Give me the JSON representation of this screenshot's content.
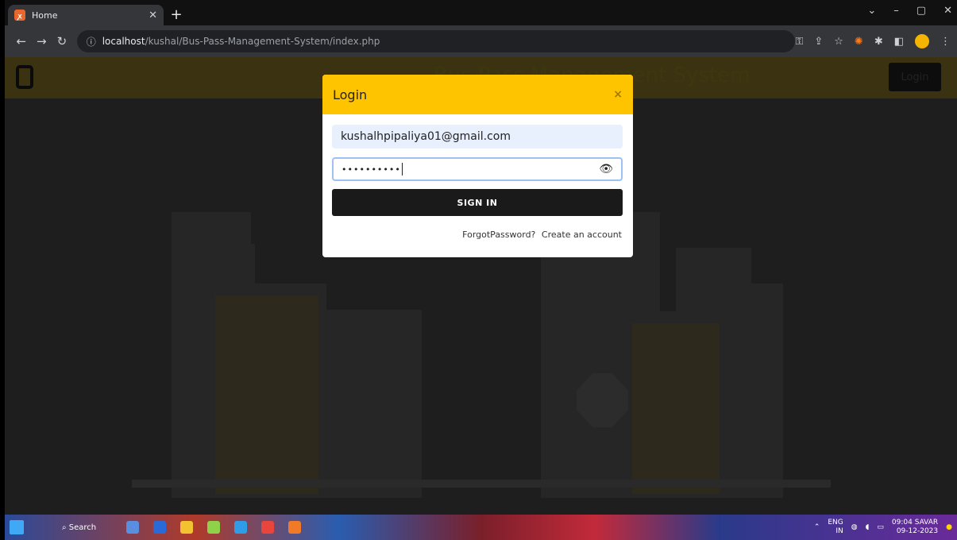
{
  "browser": {
    "tab_title": "Home",
    "tab_favicon": "xampp-icon",
    "url_host": "localhost",
    "url_path": "/kushal/Bus-Pass-Management-System/index.php"
  },
  "site": {
    "title": "Bus Pass Management System",
    "nav_login_label": "Login"
  },
  "modal": {
    "title": "Login",
    "close_label": "×",
    "email_value": "kushalhpipaliya01@gmail.com",
    "password_value": "••••••••••",
    "signin_label": "SIGN IN",
    "forgot_label": "ForgotPassword?",
    "create_label": "Create an account"
  },
  "taskbar": {
    "search_label": "Search",
    "lang_line1": "ENG",
    "lang_line2": "IN",
    "time": "09:04 SAVAR",
    "date": "09-12-2023"
  },
  "colors": {
    "accent": "#ffc400",
    "button": "#1a1a1a",
    "overlay": "#1e1e1e"
  }
}
